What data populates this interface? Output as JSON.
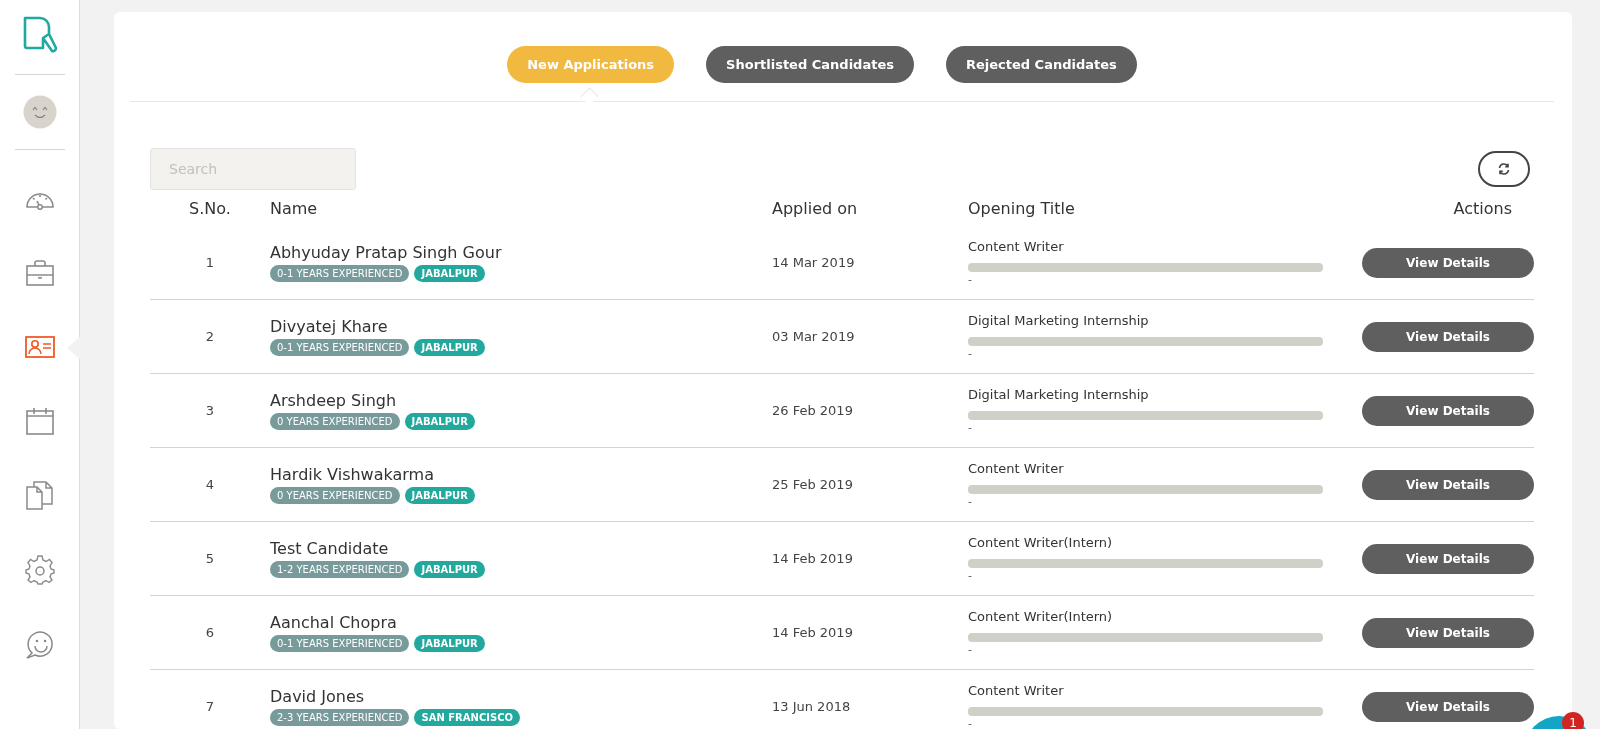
{
  "sidebar": {
    "items": [
      {
        "kind": "gauge",
        "selected": false
      },
      {
        "kind": "briefcase",
        "selected": false
      },
      {
        "kind": "idcard",
        "selected": true
      },
      {
        "kind": "calendar",
        "selected": false
      },
      {
        "kind": "documents",
        "selected": false
      },
      {
        "kind": "gear",
        "selected": false
      },
      {
        "kind": "chat",
        "selected": false
      }
    ]
  },
  "tabs": [
    {
      "label": "New Applications",
      "selected": true
    },
    {
      "label": "Shortlisted Candidates",
      "selected": false
    },
    {
      "label": "Rejected Candidates",
      "selected": false
    }
  ],
  "search": {
    "placeholder": "Search"
  },
  "table": {
    "columns": [
      "S.No.",
      "Name",
      "Applied on",
      "Opening Title",
      "Actions"
    ],
    "rows": [
      {
        "sno": "1",
        "name": "Abhyuday Pratap Singh Gour",
        "experience": "0-1 YEARS EXPERIENCED",
        "location": "JABALPUR",
        "applied_on": "14 Mar 2019",
        "opening": "Content Writer",
        "progress_text": "-",
        "action": "View Details"
      },
      {
        "sno": "2",
        "name": "Divyatej Khare",
        "experience": "0-1 YEARS EXPERIENCED",
        "location": "JABALPUR",
        "applied_on": "03 Mar 2019",
        "opening": "Digital Marketing Internship",
        "progress_text": "-",
        "action": "View Details"
      },
      {
        "sno": "3",
        "name": "Arshdeep Singh",
        "experience": "0 YEARS EXPERIENCED",
        "location": "JABALPUR",
        "applied_on": "26 Feb 2019",
        "opening": "Digital Marketing Internship",
        "progress_text": "-",
        "action": "View Details"
      },
      {
        "sno": "4",
        "name": "Hardik Vishwakarma",
        "experience": "0 YEARS EXPERIENCED",
        "location": "JABALPUR",
        "applied_on": "25 Feb 2019",
        "opening": "Content Writer",
        "progress_text": "-",
        "action": "View Details"
      },
      {
        "sno": "5",
        "name": "Test Candidate",
        "experience": "1-2 YEARS EXPERIENCED",
        "location": "JABALPUR",
        "applied_on": "14 Feb 2019",
        "opening": "Content Writer(Intern)",
        "progress_text": "-",
        "action": "View Details"
      },
      {
        "sno": "6",
        "name": "Aanchal Chopra",
        "experience": "0-1 YEARS EXPERIENCED",
        "location": "JABALPUR",
        "applied_on": "14 Feb 2019",
        "opening": "Content Writer(Intern)",
        "progress_text": "-",
        "action": "View Details"
      },
      {
        "sno": "7",
        "name": "David Jones",
        "experience": "2-3 YEARS EXPERIENCED",
        "location": "SAN FRANCISCO",
        "applied_on": "13 Jun 2018",
        "opening": "Content Writer",
        "progress_text": "-",
        "action": "View Details"
      }
    ]
  },
  "chat_widget": {
    "badge": "1"
  }
}
